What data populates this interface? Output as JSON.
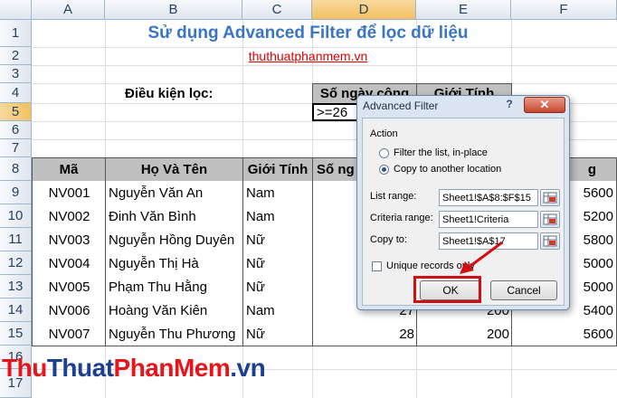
{
  "spreadsheet": {
    "columns": [
      "A",
      "B",
      "C",
      "D",
      "E",
      "F"
    ],
    "rows": [
      "1",
      "2",
      "3",
      "4",
      "5",
      "6",
      "7",
      "8",
      "9",
      "10",
      "11",
      "12",
      "13",
      "14",
      "15",
      "16",
      "17"
    ],
    "selected_row": "5",
    "selected_column": "D",
    "title": "Sử dụng Advanced Filter để lọc dữ liệu",
    "subtitle_link": "thuthuatphanmem.vn",
    "criteria_label": "Điều kiện lọc:",
    "criteria_headers": [
      "Số ngày công",
      "Giới Tính"
    ],
    "criteria_value": ">=26",
    "table_headers": [
      "Mã",
      "Họ Và Tên",
      "Giới Tính",
      "Số ng",
      "",
      "g"
    ],
    "table_rows": [
      {
        "ma": "NV001",
        "name": "Nguyễn Văn An",
        "gender": "Nam",
        "days": "",
        "rate": "",
        "salary": "5600"
      },
      {
        "ma": "NV002",
        "name": "Đinh Văn Bình",
        "gender": "Nam",
        "days": "",
        "rate": "",
        "salary": "5200"
      },
      {
        "ma": "NV003",
        "name": "Nguyễn Hồng Duyên",
        "gender": "Nữ",
        "days": "",
        "rate": "",
        "salary": "5800"
      },
      {
        "ma": "NV004",
        "name": "Nguyễn Thị Hà",
        "gender": "Nữ",
        "days": "",
        "rate": "",
        "salary": "5000"
      },
      {
        "ma": "NV005",
        "name": "Phạm Thu Hằng",
        "gender": "Nữ",
        "days": "",
        "rate": "",
        "salary": "5000"
      },
      {
        "ma": "NV006",
        "name": "Hoàng Văn Kiên",
        "gender": "Nam",
        "days": "27",
        "rate": "200",
        "salary": "5400"
      },
      {
        "ma": "NV007",
        "name": "Nguyễn Thu Phương",
        "gender": "Nữ",
        "days": "28",
        "rate": "200",
        "salary": "5600"
      }
    ]
  },
  "dialog": {
    "title": "Advanced Filter",
    "help_label": "?",
    "close_label": "✕",
    "action_label": "Action",
    "option_filter_in_place": "Filter the list, in-place",
    "option_copy_to": "Copy to another location",
    "selected_option": "copy_to",
    "list_range_label": "List range:",
    "list_range_value": "Sheet1!$A$8:$F$15",
    "criteria_range_label": "Criteria range:",
    "criteria_range_value": "Sheet1!Criteria",
    "copy_to_label": "Copy to:",
    "copy_to_value": "Sheet1!$A$17",
    "unique_records_label": "Unique records only",
    "unique_records_checked": false,
    "ok_label": "OK",
    "cancel_label": "Cancel"
  },
  "watermark": {
    "part1": "Thu",
    "part2": "Thuat",
    "part3": "PhanMem",
    "part4": ".vn"
  },
  "colors": {
    "title_blue": "#3a75c4",
    "link_red": "#e00000",
    "highlight_red": "#d01010",
    "header_gray": "#c0c0c0",
    "dialog_frame": "#dbe5f1"
  }
}
